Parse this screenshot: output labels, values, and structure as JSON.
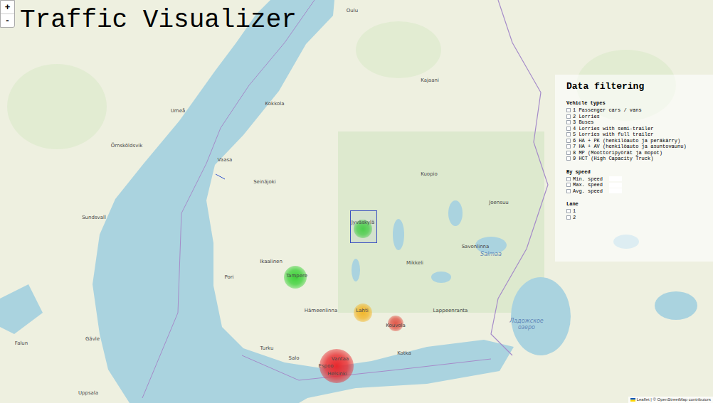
{
  "title": "Traffic Visualizer",
  "zoom": {
    "in": "+",
    "out": "-"
  },
  "map": {
    "labels": [
      {
        "text": "Oulu",
        "kind": "city"
      },
      {
        "text": "Kajaani",
        "kind": "city"
      },
      {
        "text": "Kokkola",
        "kind": "city"
      },
      {
        "text": "Umeå",
        "kind": "city"
      },
      {
        "text": "Örnsköldsvik",
        "kind": "city"
      },
      {
        "text": "Vaasa",
        "kind": "city"
      },
      {
        "text": "Seinäjoki",
        "kind": "city"
      },
      {
        "text": "Kuopio",
        "kind": "city"
      },
      {
        "text": "Joensuu",
        "kind": "city"
      },
      {
        "text": "Jyväskylä",
        "kind": "city"
      },
      {
        "text": "Sundsvall",
        "kind": "city"
      },
      {
        "text": "Ikaalinen",
        "kind": "city"
      },
      {
        "text": "Tampere",
        "kind": "city"
      },
      {
        "text": "Pori",
        "kind": "city"
      },
      {
        "text": "Mikkeli",
        "kind": "city"
      },
      {
        "text": "Savonlinna",
        "kind": "city"
      },
      {
        "text": "Saimaa",
        "kind": "water"
      },
      {
        "text": "Hämeenlinna",
        "kind": "city"
      },
      {
        "text": "Lahti",
        "kind": "city"
      },
      {
        "text": "Lappeenranta",
        "kind": "city"
      },
      {
        "text": "Kouvola",
        "kind": "city"
      },
      {
        "text": "Turku",
        "kind": "city"
      },
      {
        "text": "Salo",
        "kind": "city"
      },
      {
        "text": "Vantaa",
        "kind": "city"
      },
      {
        "text": "Espoo",
        "kind": "city"
      },
      {
        "text": "Helsinki",
        "kind": "city"
      },
      {
        "text": "Kotka",
        "kind": "city"
      },
      {
        "text": "Gävle",
        "kind": "city"
      },
      {
        "text": "Falun",
        "kind": "city"
      },
      {
        "text": "Uppsala",
        "kind": "city"
      },
      {
        "text": "Ладожское озеро",
        "kind": "water"
      }
    ],
    "hotspots": [
      {
        "color": "#e8282d",
        "level": 1
      },
      {
        "color": "#3fd23a",
        "level": 0.55
      },
      {
        "color": "#4ed447",
        "level": 0.4
      },
      {
        "color": "#f2b72c",
        "level": 0.4
      },
      {
        "color": "#e0584a",
        "level": 0.3
      }
    ],
    "selection": {
      "shown": true
    },
    "attribution": "Leaflet | © OpenStreetMap contributors"
  },
  "filters": {
    "title": "Data filtering",
    "sections": [
      {
        "heading": "Vehicle types",
        "items": [
          {
            "label": "1 Passenger cars / vans",
            "kind": "checkbox",
            "checked": false
          },
          {
            "label": "2 Lorries",
            "kind": "checkbox",
            "checked": false
          },
          {
            "label": "3 Buses",
            "kind": "checkbox",
            "checked": false
          },
          {
            "label": "4 Lorries with semi-trailer",
            "kind": "checkbox",
            "checked": false
          },
          {
            "label": "5 Lorries with full trailer",
            "kind": "checkbox",
            "checked": false
          },
          {
            "label": "6 HA + PK (henkilöauto ja peräkärry)",
            "kind": "checkbox",
            "checked": false
          },
          {
            "label": "7 HA + AV (henkilöauto ja asuntovaunu)",
            "kind": "checkbox",
            "checked": false
          },
          {
            "label": "8 MP (Moottoripyörät ja mopot)",
            "kind": "checkbox",
            "checked": false
          },
          {
            "label": "9 HCT (High Capacity Truck)",
            "kind": "checkbox",
            "checked": false
          }
        ]
      },
      {
        "heading": "By speed",
        "items": [
          {
            "label": "Min. speed",
            "kind": "number",
            "checked": false,
            "value": ""
          },
          {
            "label": "Max. speed",
            "kind": "number",
            "checked": false,
            "value": ""
          },
          {
            "label": "Avg. speed",
            "kind": "number",
            "checked": false,
            "value": ""
          }
        ]
      },
      {
        "heading": "Lane",
        "items": [
          {
            "label": "1",
            "kind": "checkbox",
            "checked": false
          },
          {
            "label": "2",
            "kind": "checkbox",
            "checked": false
          }
        ]
      }
    ]
  }
}
